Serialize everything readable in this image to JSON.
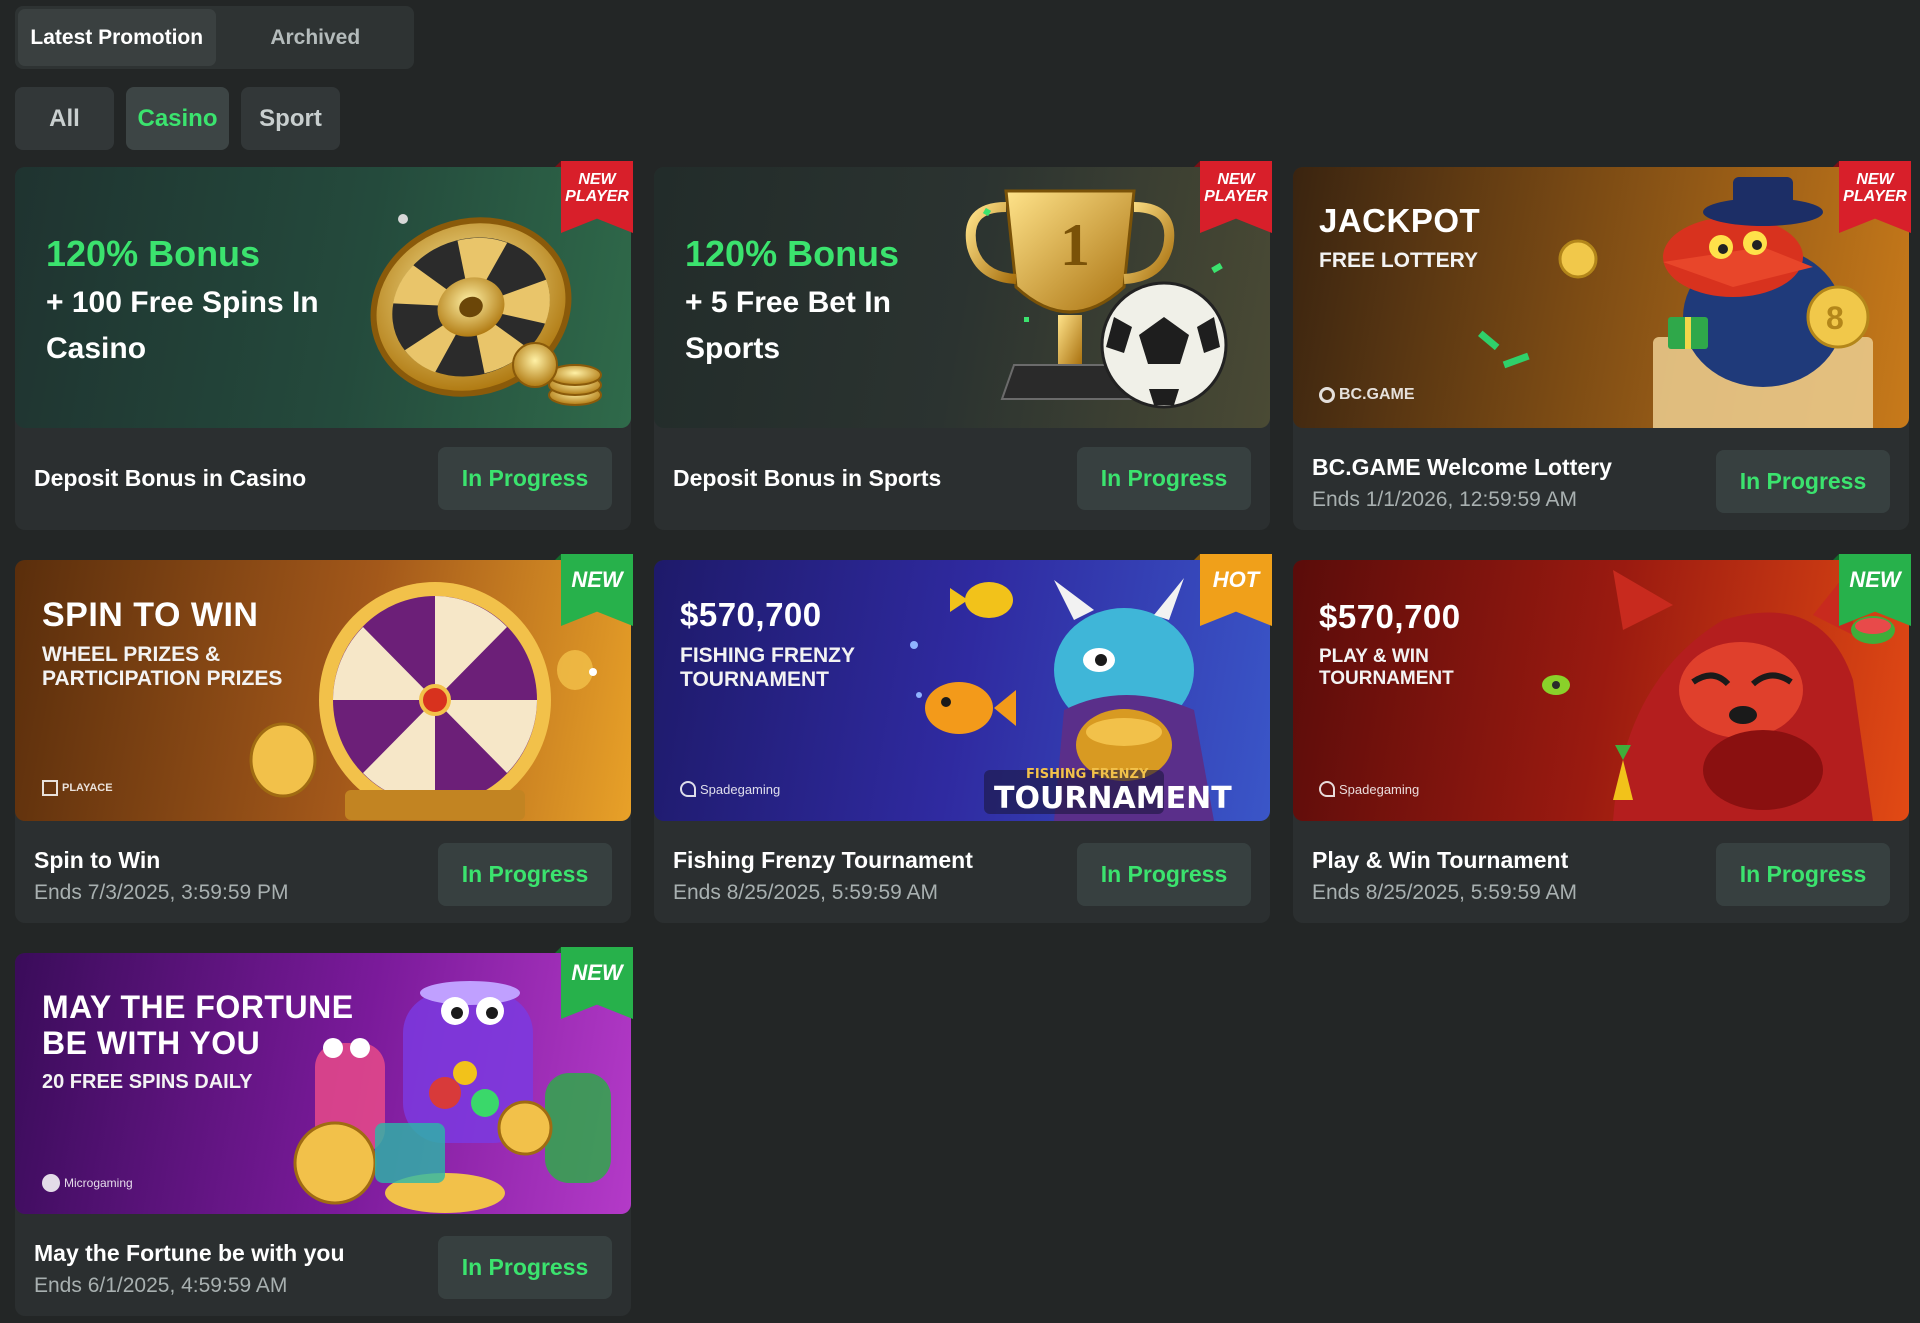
{
  "tabs": [
    {
      "label": "Latest Promotion",
      "active": true
    },
    {
      "label": "Archived",
      "active": false
    }
  ],
  "filters": [
    {
      "label": "All",
      "active": false
    },
    {
      "label": "Casino",
      "active": true
    },
    {
      "label": "Sport",
      "active": false
    }
  ],
  "colors": {
    "accent_green": "#3be36e",
    "background": "#232626",
    "card": "#2b2f30"
  },
  "cards": [
    {
      "ribbon": "NEW PLAYER",
      "ribbon_color": "red",
      "banner": {
        "headline": "120% Bonus",
        "line1": "+ 100 Free Spins In",
        "line2": "Casino",
        "art": "roulette-wheel"
      },
      "title": "Deposit Bonus in Casino",
      "subtitle": "",
      "status": "In Progress"
    },
    {
      "ribbon": "NEW PLAYER",
      "ribbon_color": "red",
      "banner": {
        "headline": "120% Bonus",
        "line1": "+ 5 Free Bet In",
        "line2": "Sports",
        "art": "trophy-and-football"
      },
      "title": "Deposit Bonus in Sports",
      "subtitle": "",
      "status": "In Progress"
    },
    {
      "ribbon": "NEW PLAYER",
      "ribbon_color": "red",
      "banner": {
        "headline": "JACKPOT",
        "line1": "FREE LOTTERY",
        "brand": "BC.GAME",
        "art": "crocodile-mascot"
      },
      "title": "BC.GAME Welcome Lottery",
      "subtitle": "Ends 1/1/2026, 12:59:59 AM",
      "status": "In Progress"
    },
    {
      "ribbon": "NEW",
      "ribbon_color": "green",
      "banner": {
        "headline": "SPIN TO WIN",
        "line1": "WHEEL PRIZES &",
        "line2": "PARTICIPATION PRIZES",
        "brand": "PLAYACE",
        "art": "prize-wheel"
      },
      "title": "Spin to Win",
      "subtitle": "Ends 7/3/2025, 3:59:59 PM",
      "status": "In Progress"
    },
    {
      "ribbon": "HOT",
      "ribbon_color": "orange",
      "banner": {
        "headline": "$570,700",
        "line1": "FISHING FRENZY",
        "line2": "TOURNAMENT",
        "brand": "Spadegaming",
        "art": "dragon-fish"
      },
      "title": "Fishing Frenzy Tournament",
      "subtitle": "Ends 8/25/2025, 5:59:59 AM",
      "status": "In Progress"
    },
    {
      "ribbon": "NEW",
      "ribbon_color": "green",
      "banner": {
        "headline": "$570,700",
        "line1": "PLAY & WIN",
        "line2": "TOURNAMENT",
        "brand": "Spadegaming",
        "art": "red-panda"
      },
      "title": "Play & Win Tournament",
      "subtitle": "Ends 8/25/2025, 5:59:59 AM",
      "status": "In Progress"
    },
    {
      "ribbon": "NEW",
      "ribbon_color": "green",
      "banner": {
        "headline": "MAY THE FORTUNE",
        "headline2": "BE WITH YOU",
        "line1": "20 FREE SPINS DAILY",
        "brand": "Microgaming",
        "art": "candy-jars"
      },
      "title": "May the Fortune be with you",
      "subtitle": "Ends 6/1/2025, 4:59:59 AM",
      "status": "In Progress"
    }
  ]
}
